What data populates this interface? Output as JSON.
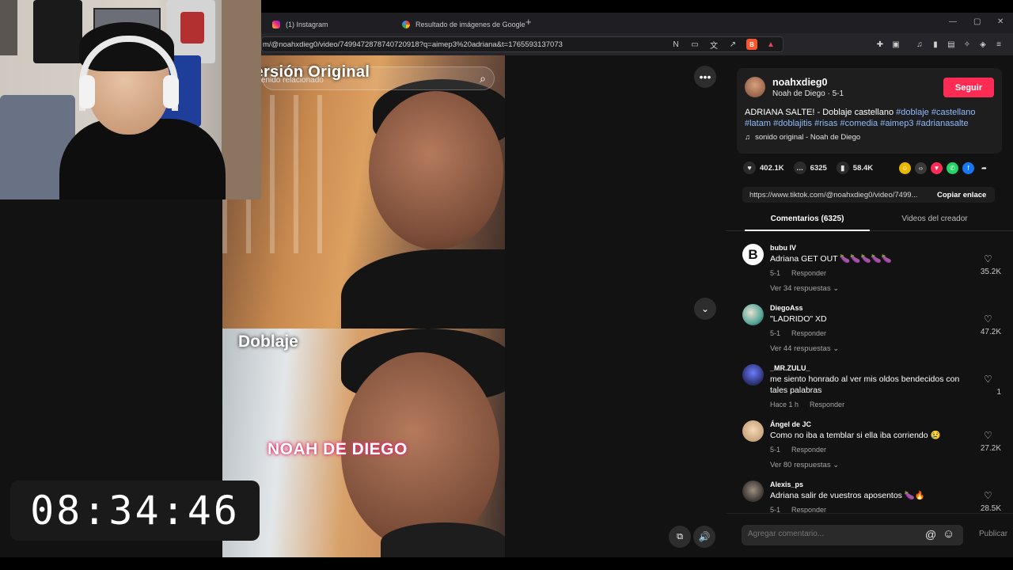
{
  "browser": {
    "tabs": [
      {
        "label": "(1) Instagram",
        "icon": "instagram-icon"
      },
      {
        "label": "Resultado de imágenes de Google",
        "icon": "google-icon"
      }
    ],
    "new_tab": "+",
    "url": "m/@noahxdieg0/video/7499472878740720918?q=aimep3%20adriana&t=1765593137073",
    "window_controls": [
      "—",
      "▢",
      "✕"
    ]
  },
  "video": {
    "overlay_top": "Versión Original",
    "overlay_top_sub": "contenido relacionado",
    "overlay_bottom": "Doblaje",
    "watermark": "NOAH DE DIEGO"
  },
  "timer": "08:34:46",
  "sidebar": {
    "author": {
      "username": "noahxdieg0",
      "nickname": "Noah de Diego · 5-1"
    },
    "follow_label": "Seguir",
    "description_plain": "ADRIANA SALTE! - Doblaje castellano ",
    "hashtags": [
      "#doblaje",
      "#castellano",
      "#latam",
      "#doblajitis",
      "#risas",
      "#comedia",
      "#aimep3",
      "#adrianasalte"
    ],
    "sound": "sonido original - Noah de Diego",
    "stats": {
      "likes": "402.1K",
      "comments": "6325",
      "saves": "58.4K"
    },
    "link": "https://www.tiktok.com/@noahxdieg0/video/7499...",
    "copy_label": "Copiar enlace",
    "tabs": {
      "comments": "Comentarios (6325)",
      "creator_videos": "Videos del creador"
    },
    "comments": [
      {
        "user": "bubu IV",
        "text": "Adriana GET OUT 🍆🍆🍆🍆🍆",
        "date": "5-1",
        "reply": "Responder",
        "more": "Ver 34 respuestas ⌄",
        "likes": "35.2K"
      },
      {
        "user": "DiegoAss",
        "text": "\"LADRIDO\" XD",
        "date": "5-1",
        "reply": "Responder",
        "more": "Ver 44 respuestas ⌄",
        "likes": "47.2K"
      },
      {
        "user": "_MR.ZULU_",
        "text": "me siento honrado al ver mis oldos bendecidos con tales palabras",
        "date": "Hace 1 h",
        "reply": "Responder",
        "more": "",
        "likes": "1"
      },
      {
        "user": "Ángel de JC",
        "text": "Como no iba a temblar si ella iba corriendo 😢",
        "date": "5-1",
        "reply": "Responder",
        "more": "Ver 80 respuestas ⌄",
        "likes": "27.2K"
      },
      {
        "user": "Alexis_ps",
        "text": "Adriana salir de vuestros aposentos 🍆🔥",
        "date": "5-1",
        "reply": "Responder",
        "more": "",
        "likes": "28.5K"
      }
    ],
    "comment_placeholder": "Agregar comentario...",
    "publish_label": "Publicar"
  },
  "colors": {
    "accent": "#fe2c55",
    "hashtag": "#8fbaff",
    "background": "#121212"
  }
}
